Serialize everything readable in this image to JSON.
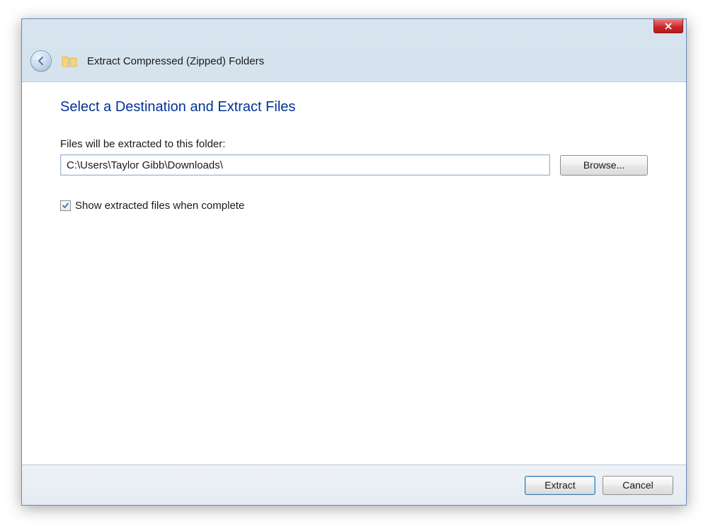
{
  "window": {
    "title": "Extract Compressed (Zipped) Folders"
  },
  "content": {
    "heading": "Select a Destination and Extract Files",
    "path_label": "Files will be extracted to this folder:",
    "path_value": "C:\\Users\\Taylor Gibb\\Downloads\\",
    "browse_label": "Browse...",
    "checkbox_label": "Show extracted files when complete",
    "checkbox_checked": true
  },
  "footer": {
    "extract_label": "Extract",
    "cancel_label": "Cancel"
  }
}
